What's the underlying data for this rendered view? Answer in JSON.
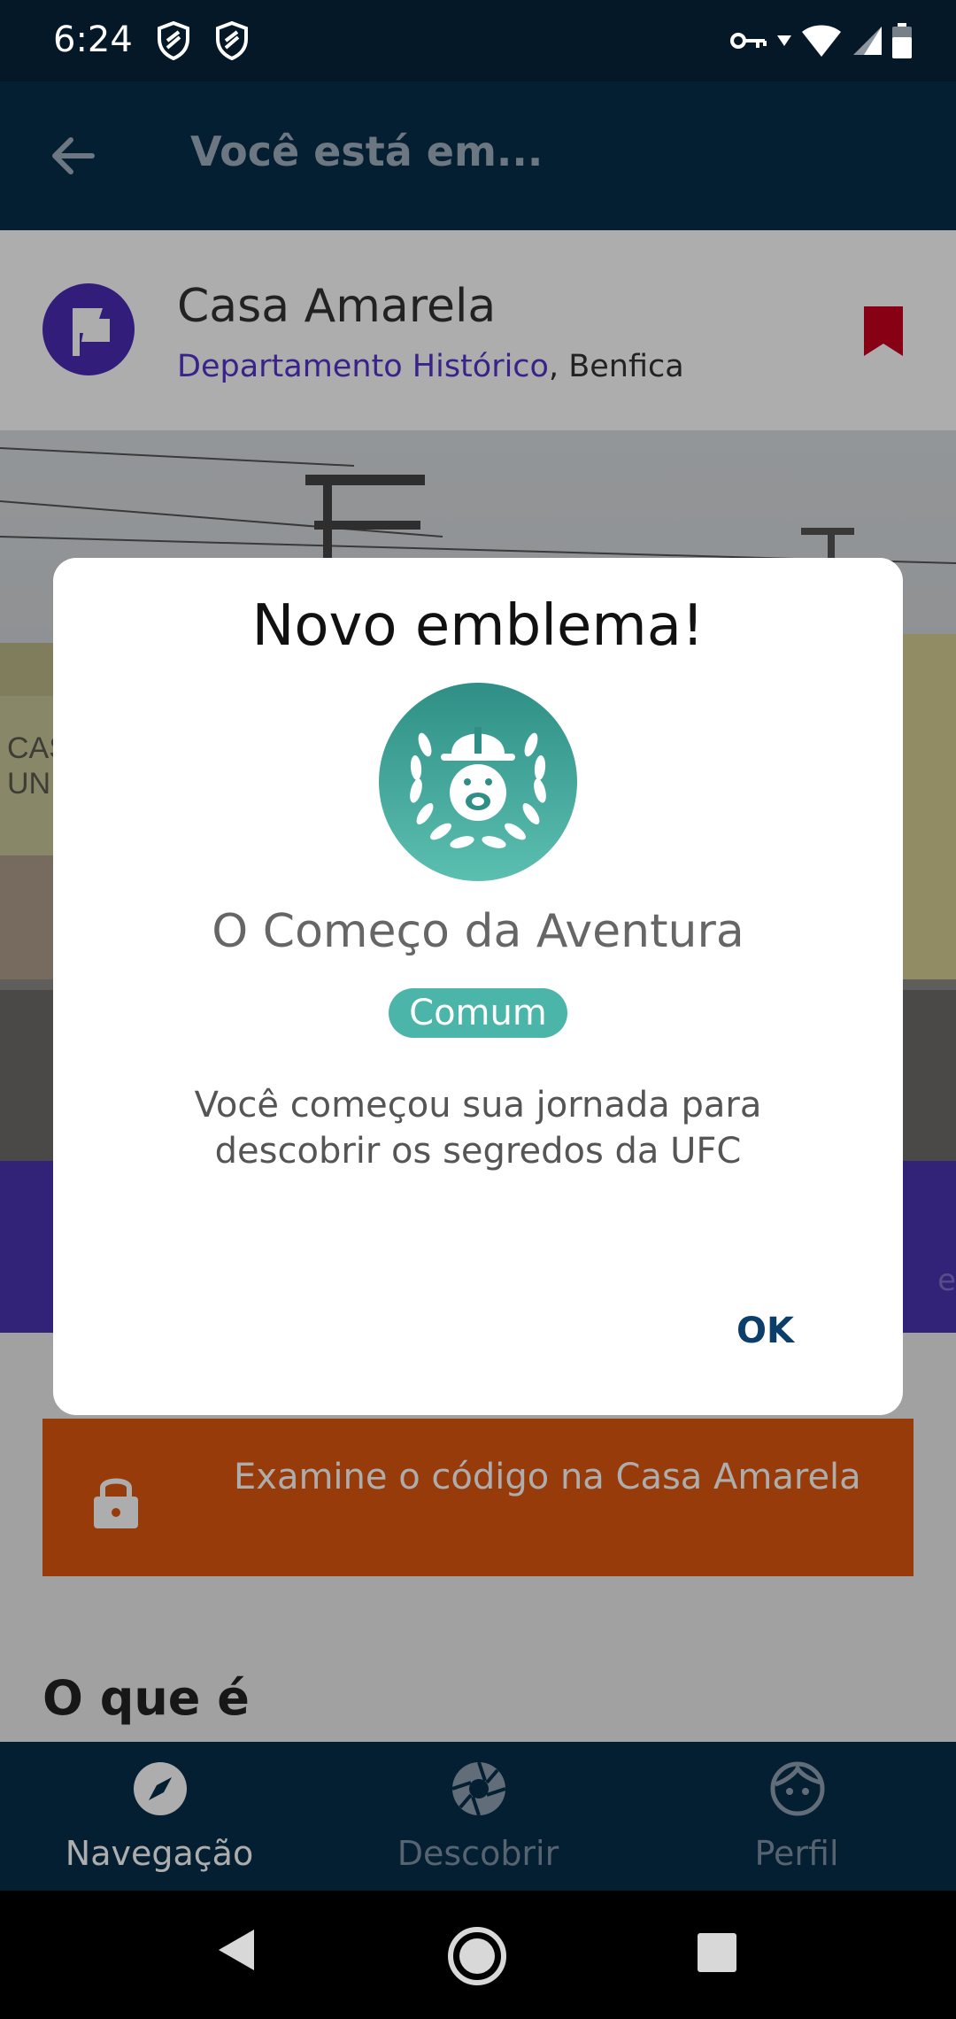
{
  "status_bar": {
    "time": "6:24"
  },
  "app_bar": {
    "title": "Você está em..."
  },
  "place": {
    "name": "Casa Amarela",
    "department": "Departamento Histórico",
    "separator": ", ",
    "neighborhood": "Benfica"
  },
  "photo": {
    "sign_line1": "CASA A",
    "sign_line2": "UNIVER"
  },
  "locked_task": {
    "text": "Examine o código na Casa Amarela"
  },
  "section": {
    "heading": "O que é"
  },
  "dialog": {
    "title": "Novo emblema!",
    "badge_name": "O Começo da Aventura",
    "rarity": "Comum",
    "description": "Você começou sua jornada para descobrir os segredos da UFC",
    "ok_label": "OK"
  },
  "bottom_nav": {
    "items": [
      {
        "label": "Navegação",
        "icon": "compass-icon"
      },
      {
        "label": "Descobrir",
        "icon": "camera-shutter-icon"
      },
      {
        "label": "Perfil",
        "icon": "face-icon"
      }
    ]
  },
  "colors": {
    "app_bar": "#072d4a",
    "accent_purple": "#4b34b3",
    "locked_orange": "#e0570f",
    "badge_teal": "#4ab5a8",
    "ok_blue": "#0b3e6b",
    "bookmark_red": "#c8001e"
  }
}
